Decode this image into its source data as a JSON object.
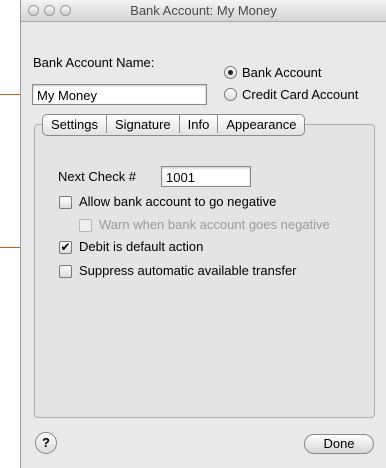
{
  "window": {
    "title": "Bank Account: My Money",
    "account_name_label": "Bank Account Name:",
    "account_name_value": "My Money",
    "account_type_options": [
      {
        "label": "Bank Account",
        "selected": true
      },
      {
        "label": "Credit Card Account",
        "selected": false
      }
    ]
  },
  "tabs": [
    {
      "label": "Settings",
      "selected": true
    },
    {
      "label": "Signature",
      "selected": false
    },
    {
      "label": "Info",
      "selected": false
    },
    {
      "label": "Appearance",
      "selected": false
    }
  ],
  "settings": {
    "next_check_label": "Next Check #",
    "next_check_value": "1001",
    "options": [
      {
        "label": "Allow bank account to go negative",
        "checked": false,
        "enabled": true
      },
      {
        "label": "Warn when bank account goes negative",
        "checked": false,
        "enabled": false
      },
      {
        "label": "Debit is default action",
        "checked": true,
        "enabled": true
      },
      {
        "label": "Suppress automatic available transfer",
        "checked": false,
        "enabled": true
      }
    ]
  },
  "footer": {
    "help_label": "?",
    "done_label": "Done"
  },
  "colors": {
    "callout": "#cf5a12",
    "window_bg": "#e9e9e9"
  }
}
